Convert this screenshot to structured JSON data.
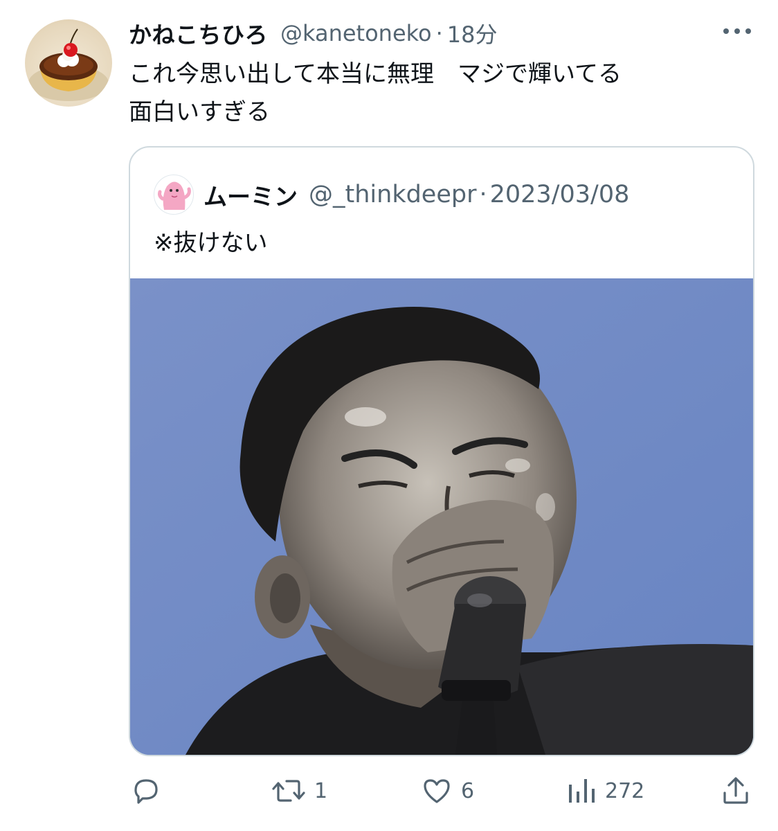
{
  "tweet": {
    "author": {
      "display_name": "かねこちひろ",
      "handle": "@kanetoneko",
      "avatar_icon": "pudding-avatar-icon"
    },
    "separator": "·",
    "time": "18分",
    "text": "これ今思い出して本当に無理　マジで輝いてる\n面白いすぎる",
    "more_icon": "more-dots-icon"
  },
  "quoted_tweet": {
    "author": {
      "display_name": "ムーミン",
      "handle": "@_thinkdeepr",
      "avatar_icon": "pink-character-avatar-icon"
    },
    "separator": "·",
    "date": "2023/03/08",
    "text": "※抜けない",
    "media": {
      "description_icon": "photo-singer-with-microphone",
      "background_color": "#7390c8"
    }
  },
  "actions": {
    "reply": {
      "icon": "reply-icon",
      "count": ""
    },
    "retweet": {
      "icon": "retweet-icon",
      "count": "1"
    },
    "like": {
      "icon": "heart-icon",
      "count": "6"
    },
    "views": {
      "icon": "views-icon",
      "count": "272"
    },
    "share": {
      "icon": "share-icon"
    }
  },
  "colors": {
    "text_primary": "#0f1419",
    "text_secondary": "#536471",
    "border": "#cfd9de"
  }
}
